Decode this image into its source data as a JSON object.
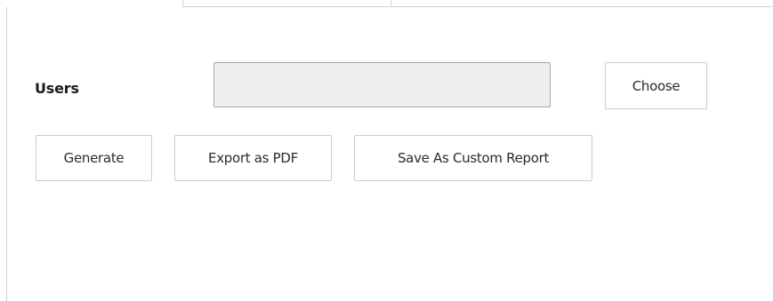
{
  "tabs": [
    {
      "label": ""
    },
    {
      "label": ""
    }
  ],
  "form": {
    "users_label": "Users",
    "users_value": "",
    "users_placeholder": ""
  },
  "buttons": {
    "choose": "Choose",
    "generate": "Generate",
    "export_pdf": "Export as PDF",
    "save_custom_report": "Save As Custom Report"
  },
  "colors": {
    "field_background": "#eeeeee",
    "border": "#cccccc"
  }
}
